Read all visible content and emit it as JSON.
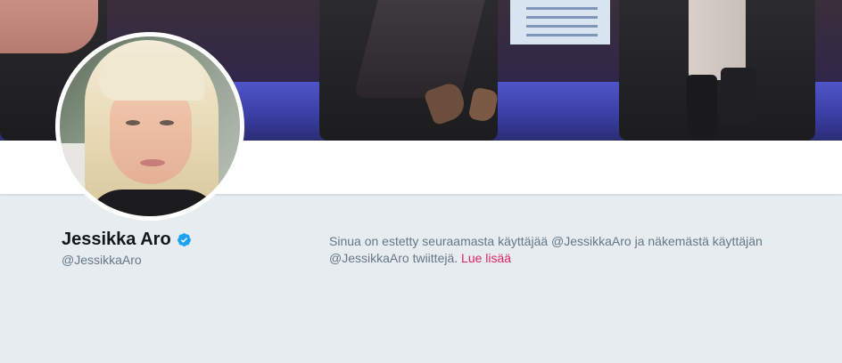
{
  "profile": {
    "display_name": "Jessikka Aro",
    "handle": "@JessikkaAro",
    "verified": true
  },
  "blocked_notice": {
    "text": "Sinua on estetty seuraamasta käyttäjää @JessikkaAro ja näkemästä käyttäjän @JessikkaAro twiittejä.",
    "link_label": "Lue lisää"
  },
  "colors": {
    "verified_badge": "#1da1f2",
    "link_accent": "#e0245e",
    "page_background": "#e6ecf0"
  },
  "icons": {
    "verified": "verified-badge-icon"
  }
}
